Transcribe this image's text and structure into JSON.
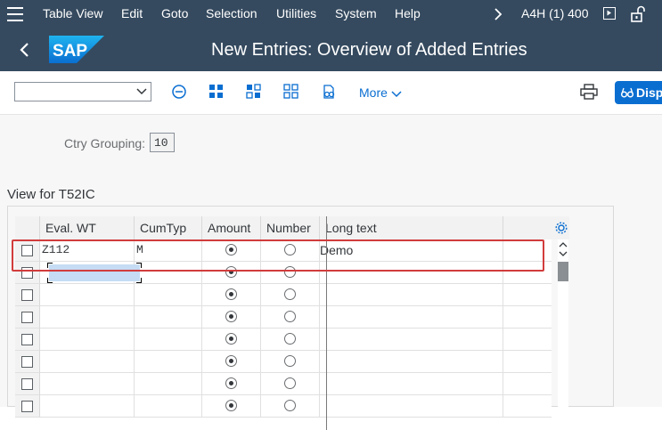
{
  "menubar": {
    "items": [
      "Table View",
      "Edit",
      "Goto",
      "Selection",
      "Utilities",
      "System",
      "Help"
    ],
    "system_info": "A4H (1) 400"
  },
  "titlebar": {
    "logo_text": "SAP",
    "title": "New Entries: Overview of Added Entries"
  },
  "toolbar": {
    "more_label": "More",
    "display_label": "Disp"
  },
  "header_fields": {
    "ctry_label": "Ctry Grouping:",
    "ctry_value": "10"
  },
  "section_title": "View for T52IC",
  "table": {
    "columns": [
      "Eval. WT",
      "CumTyp",
      "Amount",
      "Number",
      "Long text"
    ],
    "rows": [
      {
        "eval_wt": "Z112",
        "cumtyp": "M",
        "amount": true,
        "number": false,
        "long_text": "Demo"
      },
      {
        "eval_wt": "",
        "cumtyp": "",
        "amount": true,
        "number": false,
        "long_text": ""
      },
      {
        "eval_wt": "",
        "cumtyp": "",
        "amount": true,
        "number": false,
        "long_text": ""
      },
      {
        "eval_wt": "",
        "cumtyp": "",
        "amount": true,
        "number": false,
        "long_text": ""
      },
      {
        "eval_wt": "",
        "cumtyp": "",
        "amount": true,
        "number": false,
        "long_text": ""
      },
      {
        "eval_wt": "",
        "cumtyp": "",
        "amount": true,
        "number": false,
        "long_text": ""
      },
      {
        "eval_wt": "",
        "cumtyp": "",
        "amount": true,
        "number": false,
        "long_text": ""
      },
      {
        "eval_wt": "",
        "cumtyp": "",
        "amount": true,
        "number": false,
        "long_text": ""
      }
    ]
  },
  "colors": {
    "shell_bg": "#354a5f",
    "accent": "#0a6ed1",
    "highlight_border": "#d23c3c",
    "focus_fill": "#c5dcf4"
  },
  "icons": [
    "menu-icon",
    "chevron-right-icon",
    "play-icon",
    "unlock-icon",
    "back-icon",
    "sap-logo",
    "chevron-down-icon",
    "minus-circle-icon",
    "select-all-icon",
    "deselect-all-icon",
    "select-block-icon",
    "details-icon",
    "print-icon",
    "glasses-icon",
    "settings-icon"
  ]
}
